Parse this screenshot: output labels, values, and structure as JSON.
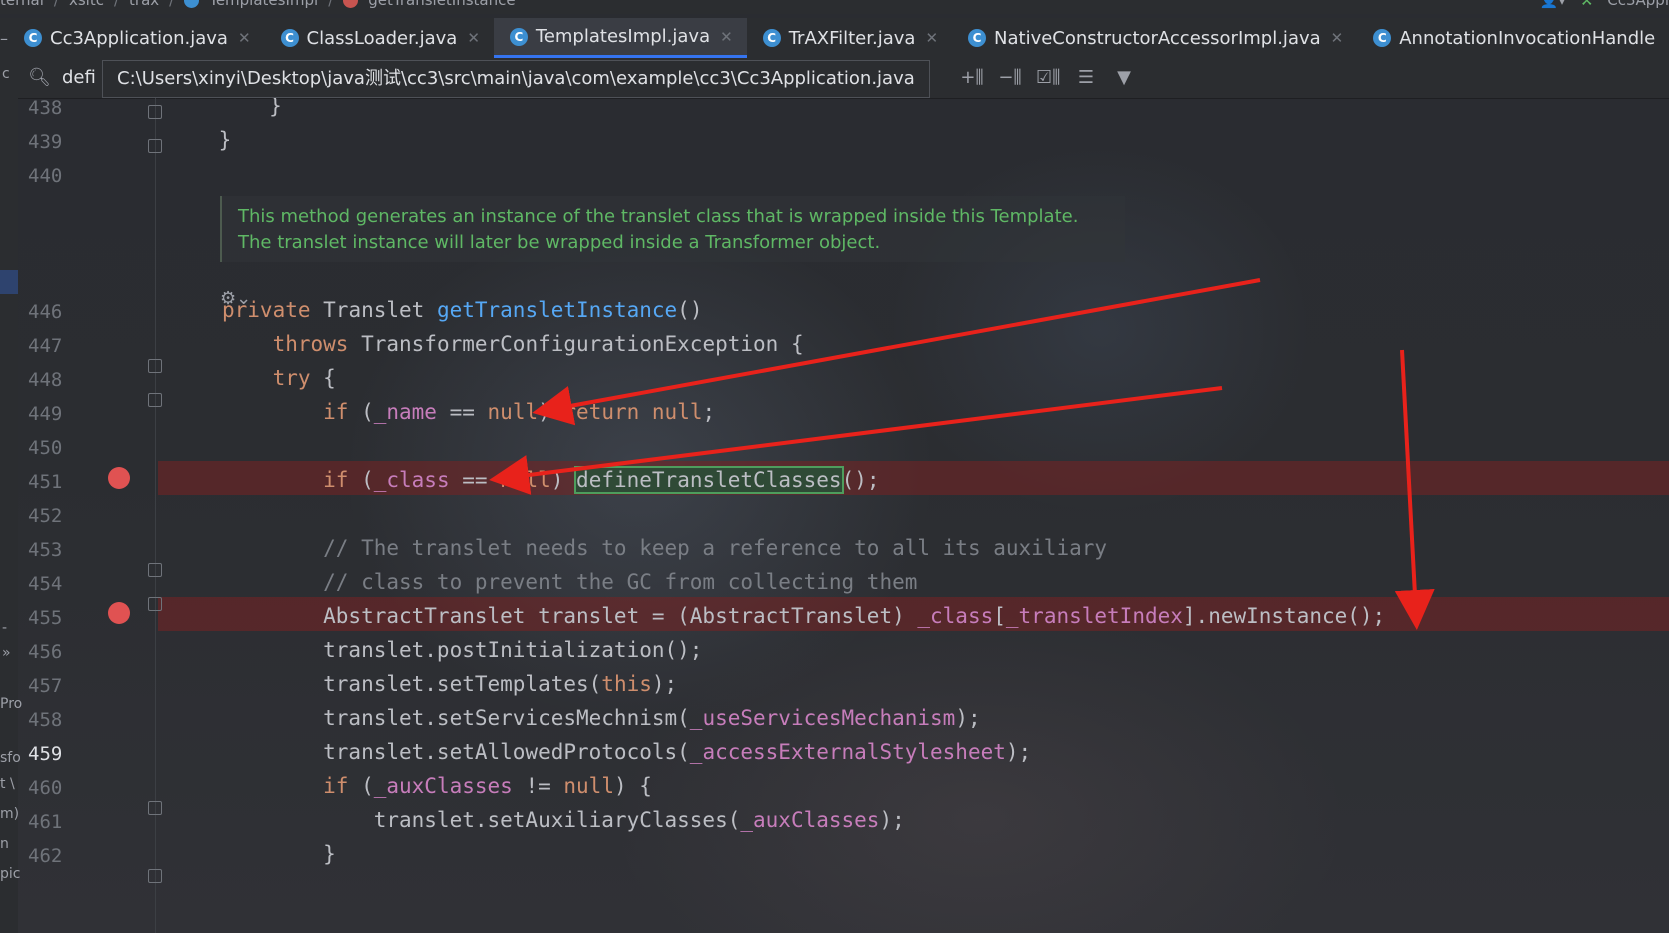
{
  "breadcrumb": {
    "items": [
      "ternal",
      "xsltc",
      "trax",
      "TemplatesImpl",
      "getTransletInstance"
    ],
    "right_label": "Cc3Appl"
  },
  "tabs": [
    {
      "label": "Cc3Application.java",
      "active": false
    },
    {
      "label": "ClassLoader.java",
      "active": false
    },
    {
      "label": "TemplatesImpl.java",
      "active": true
    },
    {
      "label": "TrAXFilter.java",
      "active": false
    },
    {
      "label": "NativeConstructorAccessorImpl.java",
      "active": false
    },
    {
      "label": "AnnotationInvocationHandle",
      "active": false
    }
  ],
  "findbar": {
    "query": "defi",
    "tooltip_path": "C:\\Users\\xinyi\\Desktop\\java测试\\cc3\\src\\main\\java\\com\\example\\cc3\\Cc3Application.java"
  },
  "left_edge": [
    "c",
    "-",
    "-",
    "»",
    "Pro",
    "sfo",
    "t \\",
    "m)",
    "n",
    "pic"
  ],
  "doc_comment": "This method generates an instance of the translet class that is wrapped inside this Template. The translet instance will later be wrapped inside a Transformer object.",
  "line_numbers": {
    "l438": "438",
    "l439": "439",
    "l440": "440",
    "l446": "446",
    "l447": "447",
    "l448": "448",
    "l449": "449",
    "l450": "450",
    "l451": "451",
    "l452": "452",
    "l453": "453",
    "l454": "454",
    "l455": "455",
    "l456": "456",
    "l457": "457",
    "l458": "458",
    "l459": "459",
    "l460": "460",
    "l461": "461",
    "l462": "462"
  },
  "code": {
    "l438": "        }",
    "l439": "    }",
    "l446_a": "private",
    "l446_b": " Translet ",
    "l446_c": "getTransletInstance",
    "l446_d": "()",
    "l447_a": "    throws",
    "l447_b": " TransformerConfigurationException {",
    "l448_a": "    try",
    "l448_b": " {",
    "l449_a": "        if",
    "l449_b": " (",
    "l449_c": "_name",
    "l449_d": " == ",
    "l449_e": "null",
    "l449_f": ") ",
    "l449_g": "return null",
    "l449_h": ";",
    "l451_a": "        if",
    "l451_b": " (",
    "l451_c": "_class",
    "l451_d": " == ",
    "l451_e": "null",
    "l451_f": ") ",
    "l451_g": "defineTransletClasses",
    "l451_h": "();",
    "l453": "        // The translet needs to keep a reference to all its auxiliary",
    "l454": "        // class to prevent the GC from collecting them",
    "l455_a": "        AbstractTranslet translet = (AbstractTranslet) ",
    "l455_b": "_class",
    "l455_c": "[",
    "l455_d": "_transletIndex",
    "l455_e": "].newInstance();",
    "l456": "        translet.postInitialization();",
    "l457_a": "        translet.setTemplates(",
    "l457_b": "this",
    "l457_c": ");",
    "l458_a": "        translet.setServicesMechnism(",
    "l458_b": "_useServicesMechanism",
    "l458_c": ");",
    "l459_a": "        translet.setAllowedProtocols(",
    "l459_b": "_accessExternalStylesheet",
    "l459_c": ");",
    "l460_a": "        if",
    "l460_b": " (",
    "l460_c": "_auxClasses",
    "l460_d": " != ",
    "l460_e": "null",
    "l460_f": ") {",
    "l461_a": "            translet.setAuxiliaryClasses(",
    "l461_b": "_auxClasses",
    "l461_c": ");",
    "l462": "        }"
  },
  "colors": {
    "keyword": "#cf8e6d",
    "field": "#c77dbb",
    "comment": "#7a7e85",
    "doc": "#5fb865",
    "breakpoint": "#e05252",
    "arrow": "#e8221b"
  }
}
